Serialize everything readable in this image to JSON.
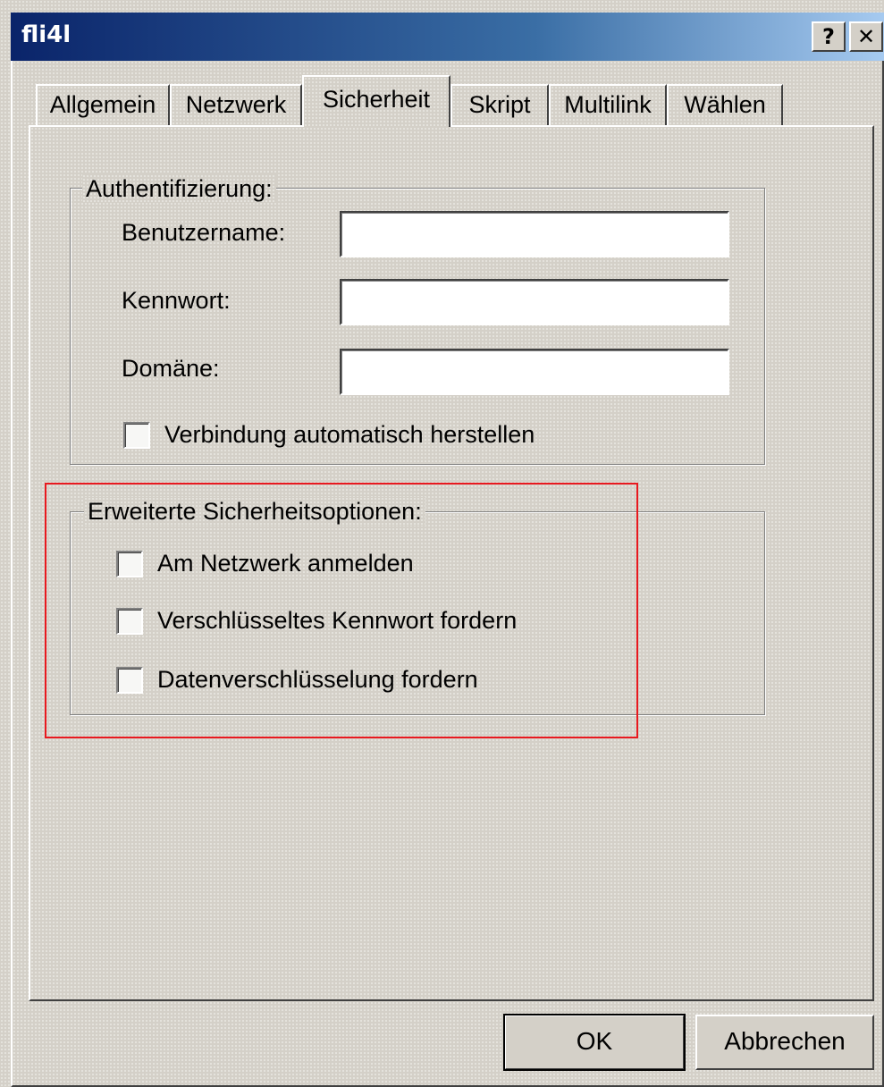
{
  "window": {
    "title": "fli4l",
    "help_button": "?",
    "close_button": "✕"
  },
  "tabs": [
    {
      "label": "Allgemein",
      "active": false
    },
    {
      "label": "Netzwerk",
      "active": false
    },
    {
      "label": "Sicherheit",
      "active": true
    },
    {
      "label": "Skript",
      "active": false
    },
    {
      "label": "Multilink",
      "active": false
    },
    {
      "label": "Wählen",
      "active": false
    }
  ],
  "authentication": {
    "title": "Authentifizierung:",
    "username_label": "Benutzername:",
    "username_value": "",
    "password_label": "Kennwort:",
    "password_value": "",
    "domain_label": "Domäne:",
    "domain_value": "",
    "auto_connect_label": "Verbindung automatisch herstellen",
    "auto_connect_checked": false
  },
  "advanced": {
    "title": "Erweiterte Sicherheitsoptionen:",
    "options": [
      {
        "label": "Am Netzwerk anmelden",
        "checked": false
      },
      {
        "label": "Verschlüsseltes Kennwort fordern",
        "checked": false
      },
      {
        "label": "Datenverschlüsselung fordern",
        "checked": false
      }
    ]
  },
  "buttons": {
    "ok": "OK",
    "cancel": "Abbrechen"
  },
  "colors": {
    "highlight_box": "#e8191f",
    "titlebar_start": "#0a246a",
    "face": "#d4d0c8"
  }
}
